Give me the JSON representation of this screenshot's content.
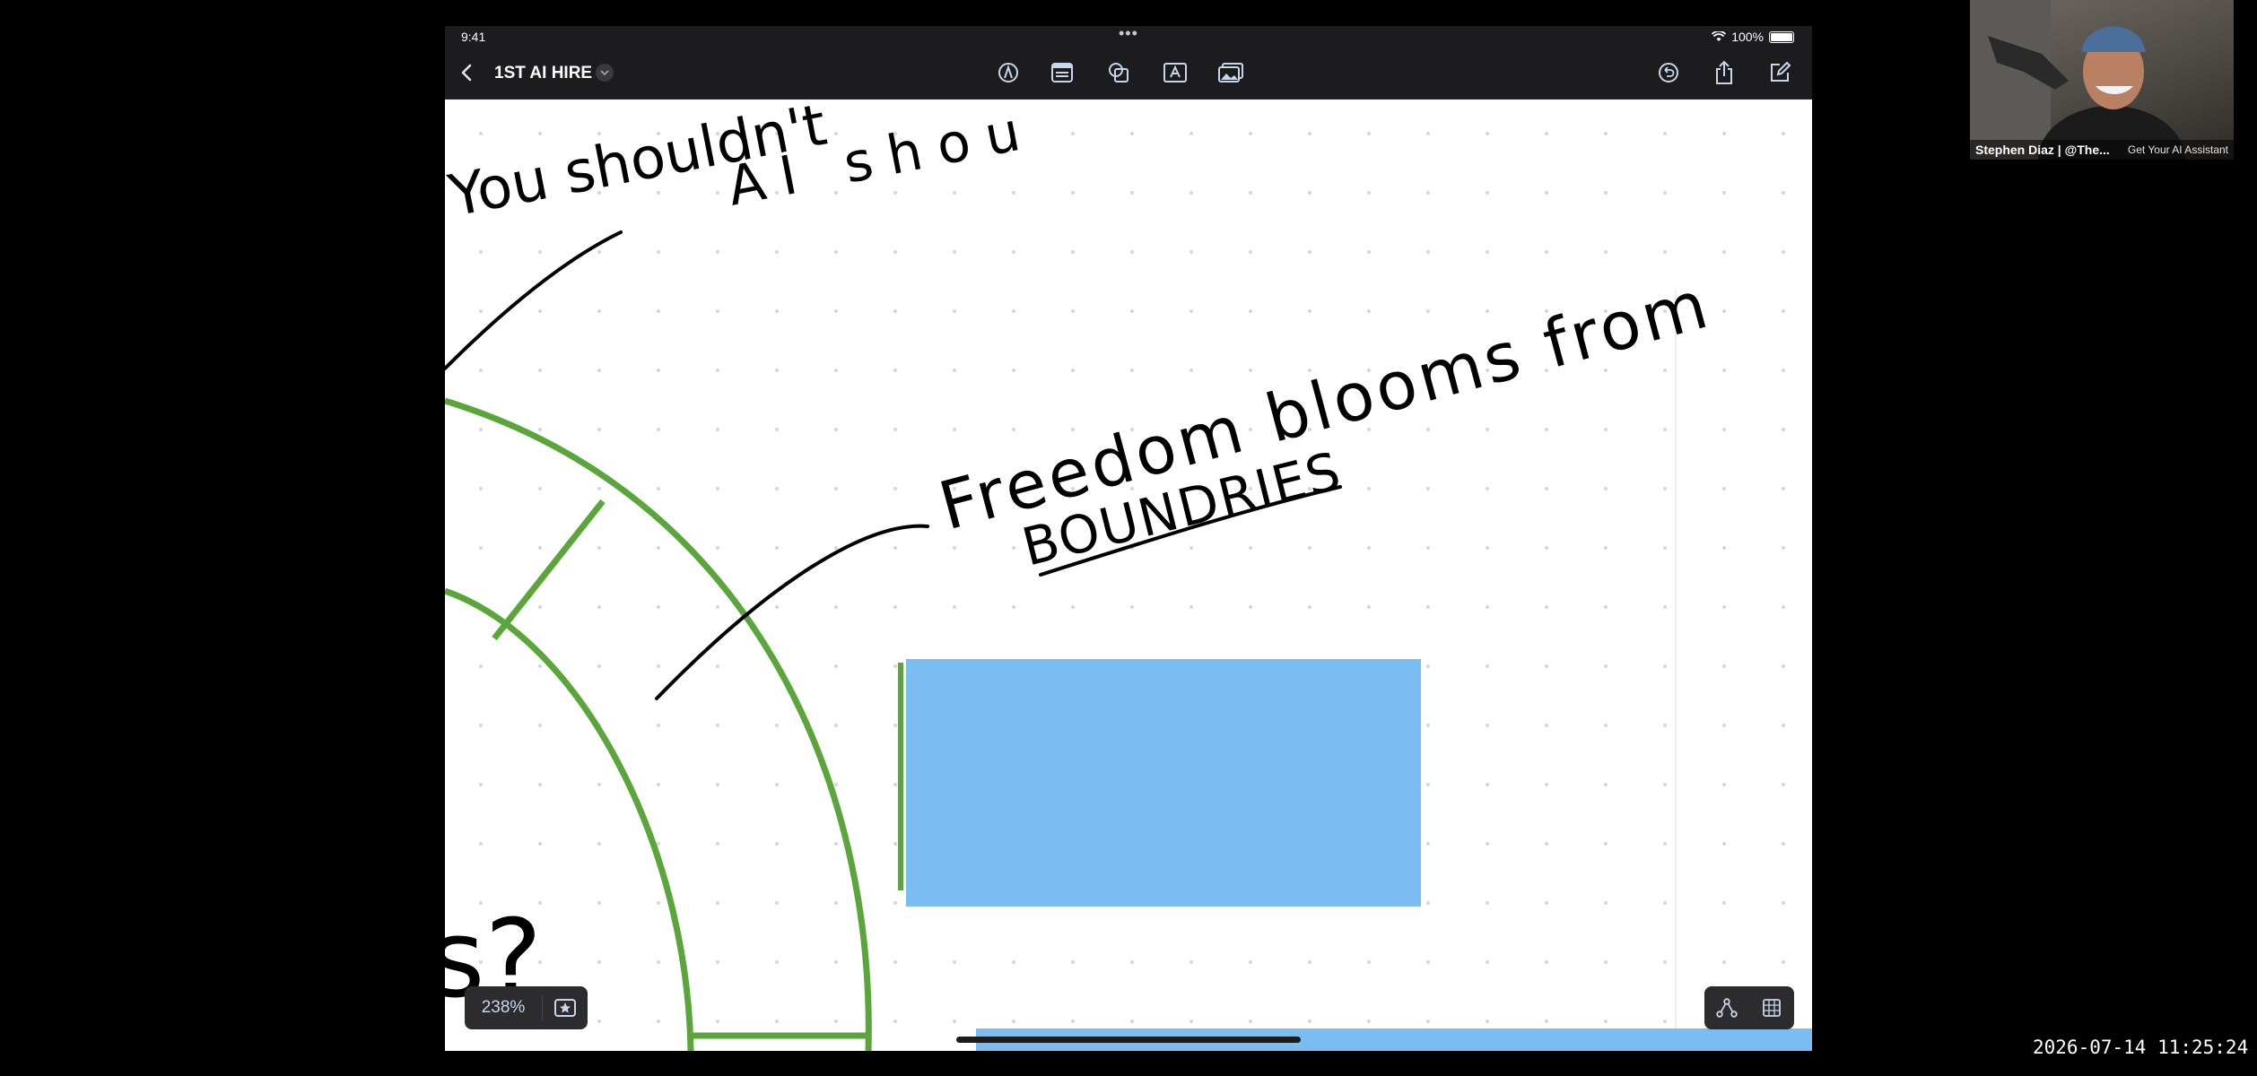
{
  "status_bar": {
    "time": "9:41",
    "battery": "100%"
  },
  "toolbar": {
    "document_title": "1ST AI HIRE"
  },
  "canvas": {
    "handwriting": {
      "line1": "You shouldn't",
      "line2": "AI shou",
      "quote1": "Freedom blooms from",
      "quote2": "BOUNDRIES",
      "fragment": "s?"
    },
    "colors": {
      "green_ring": "#5aa63a",
      "blue_rect": "#7bbdf0",
      "ink": "#000000"
    }
  },
  "zoom": {
    "value": "238%"
  },
  "webcam": {
    "name": "Stephen Diaz | @The...",
    "caption": "Get Your AI Assistant"
  },
  "recording": {
    "timestamp": "2026-07-14 11:25:24"
  }
}
